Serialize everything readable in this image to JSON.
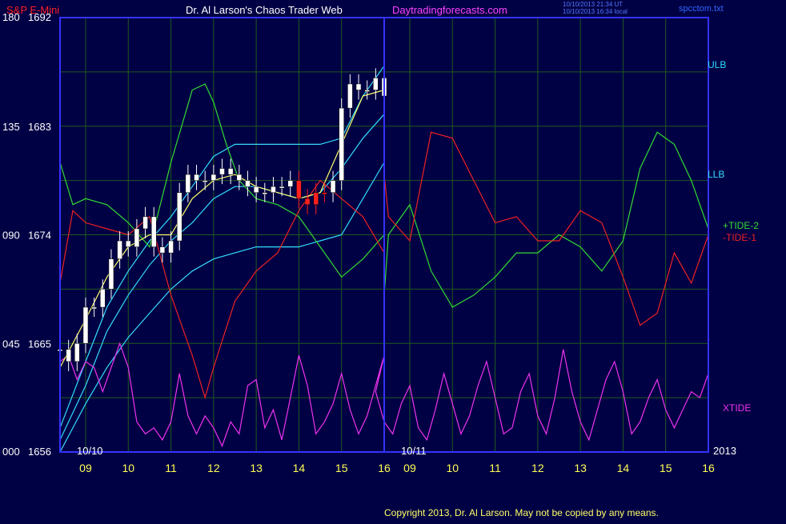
{
  "header": {
    "instrument": "S&P E-Mini",
    "title": "Dr. Al Larson's Chaos Trader Web",
    "website": "Daytradingforecasts.com",
    "timestamp_line1": "10/10/2013 21:34 UT",
    "timestamp_line2": "10/10/2013 16:34 local",
    "filename": "spcctom.txt"
  },
  "footer": {
    "copyright": "Copyright 2013, Dr. Al Larson. May not be copied by any means."
  },
  "colors": {
    "background": "#000044",
    "frame": "#3333ff",
    "grid": "#1f5a1f",
    "price_up": "#ffffff",
    "price_down": "#000000",
    "price_highlight": "#ff2020",
    "ulb": "#33ddff",
    "llb": "#33ddff",
    "tide_plus": "#33dd33",
    "tide_minus": "#ee2222",
    "xtide": "#ee33ee",
    "ma_yellow": "#ffff66",
    "axis_text": "#ffffff",
    "hour_labels": "#ffff55"
  },
  "chart_data": {
    "type": "line",
    "title": "S&P E-Mini",
    "xlabel": "",
    "ylabel": "",
    "ylim": [
      1656,
      1692
    ],
    "y_left_scale": [
      0,
      180
    ],
    "grid": true,
    "legend_position": "right",
    "y_ticks": [
      {
        "left": "180",
        "price": "1692",
        "value": 1692
      },
      {
        "left": "135",
        "price": "1683",
        "value": 1683
      },
      {
        "left": "090",
        "price": "1674",
        "value": 1674
      },
      {
        "left": "045",
        "price": "1665",
        "value": 1665
      },
      {
        "left": "000",
        "price": "1656",
        "value": 1656
      }
    ],
    "x_hour_ticks": [
      "09",
      "10",
      "11",
      "12",
      "13",
      "14",
      "15",
      "16",
      "09",
      "10",
      "11",
      "12",
      "13",
      "14",
      "15",
      "16"
    ],
    "date_labels": [
      "10/10",
      "10/11"
    ],
    "year_label": "2013",
    "series_labels": {
      "ulb": "ULB",
      "llb": "LLB",
      "tide_plus": "+TIDE-2",
      "tide_minus": "-TIDE-1",
      "xtide": "XTIDE"
    },
    "price_bars": {
      "hours": [
        8.4,
        8.6,
        8.8,
        9.0,
        9.2,
        9.4,
        9.6,
        9.8,
        10.0,
        10.2,
        10.4,
        10.6,
        10.8,
        11.0,
        11.2,
        11.4,
        11.6,
        11.8,
        12.0,
        12.2,
        12.4,
        12.6,
        12.8,
        13.0,
        13.2,
        13.4,
        13.6,
        13.8,
        14.0,
        14.2,
        14.4,
        14.6,
        14.8,
        15.0,
        15.2,
        15.4,
        15.6,
        15.8,
        16.0
      ],
      "prices": [
        1664.5,
        1663.5,
        1665.0,
        1668.0,
        1668.0,
        1669.5,
        1672.0,
        1673.5,
        1673.0,
        1674.5,
        1675.5,
        1673.0,
        1672.5,
        1673.5,
        1677.5,
        1679.0,
        1678.5,
        1678.5,
        1679.0,
        1679.5,
        1679.0,
        1678.5,
        1678.0,
        1677.5,
        1677.5,
        1678.0,
        1678.0,
        1678.5,
        1677.0,
        1676.5,
        1677.5,
        1677.5,
        1678.5,
        1684.5,
        1686.5,
        1686.0,
        1686.0,
        1687.0,
        1685.5
      ],
      "highlight_hours": [
        14.0,
        14.2,
        14.4,
        14.6
      ]
    },
    "ma_line": {
      "hours": [
        8.4,
        9.0,
        9.5,
        10.0,
        10.5,
        11.0,
        11.5,
        12.0,
        12.5,
        13.0,
        13.5,
        14.0,
        14.5,
        15.0,
        15.5,
        16.0
      ],
      "prices": [
        1663.0,
        1667.0,
        1670.5,
        1673.0,
        1674.0,
        1674.0,
        1677.0,
        1678.5,
        1679.0,
        1678.0,
        1677.5,
        1677.0,
        1677.5,
        1681.5,
        1685.5,
        1686.0
      ]
    },
    "series": [
      {
        "name": "ULB",
        "hours": [
          8.4,
          9.0,
          9.5,
          10.0,
          10.5,
          11.0,
          11.5,
          12.0,
          12.5,
          13.0,
          13.5,
          14.0,
          14.5,
          15.0,
          15.5,
          16.0
        ],
        "values": [
          1658.0,
          1663.5,
          1668.0,
          1671.0,
          1673.5,
          1675.5,
          1678.0,
          1680.5,
          1681.5,
          1681.5,
          1681.5,
          1681.5,
          1681.5,
          1682.0,
          1685.5,
          1688.0
        ]
      },
      {
        "name": "Middle band",
        "hours": [
          8.4,
          9.0,
          9.5,
          10.0,
          10.5,
          11.0,
          11.5,
          12.0,
          12.5,
          13.0,
          13.5,
          14.0,
          14.5,
          15.0,
          15.5,
          16.0
        ],
        "values": [
          1657.0,
          1661.5,
          1666.0,
          1669.0,
          1671.5,
          1673.5,
          1675.0,
          1677.0,
          1678.0,
          1678.0,
          1677.5,
          1677.0,
          1677.5,
          1679.5,
          1682.0,
          1684.0
        ]
      },
      {
        "name": "LLB",
        "hours": [
          8.4,
          9.0,
          9.5,
          10.0,
          10.5,
          11.0,
          11.5,
          12.0,
          12.5,
          13.0,
          13.5,
          14.0,
          14.5,
          15.0,
          15.5,
          16.0
        ],
        "values": [
          1656.0,
          1660.0,
          1663.0,
          1665.5,
          1667.5,
          1669.5,
          1671.0,
          1672.0,
          1672.5,
          1673.0,
          1673.0,
          1673.0,
          1673.5,
          1674.0,
          1677.0,
          1680.0
        ]
      },
      {
        "name": "+TIDE-2",
        "hours": [
          8.4,
          8.7,
          9.0,
          9.5,
          10.0,
          10.5,
          11.0,
          11.5,
          11.8,
          12.0,
          12.3,
          12.6,
          13.0,
          13.5,
          14.0,
          14.5,
          15.0,
          15.5,
          16.0,
          16.0,
          16.5,
          17.0,
          17.5,
          18.0,
          18.5,
          19.0,
          19.5,
          20.0,
          20.5,
          21.0,
          21.5,
          22.0,
          22.4,
          22.8,
          23.2,
          23.6,
          24.0
        ],
        "values": [
          1680.0,
          1676.5,
          1677.0,
          1676.5,
          1675.0,
          1673.0,
          1680.0,
          1686.0,
          1686.5,
          1685.0,
          1681.5,
          1678.5,
          1677.0,
          1676.5,
          1675.5,
          1673.0,
          1670.5,
          1672.0,
          1674.0,
          1669.0,
          1674.0,
          1676.5,
          1671.0,
          1668.0,
          1669.0,
          1670.5,
          1672.5,
          1672.5,
          1674.0,
          1673.0,
          1671.0,
          1673.5,
          1679.5,
          1682.5,
          1681.5,
          1678.5,
          1674.5
        ]
      },
      {
        "name": "-TIDE-1",
        "hours": [
          8.4,
          8.7,
          9.0,
          9.5,
          10.0,
          10.5,
          11.0,
          11.5,
          11.8,
          12.0,
          12.5,
          13.0,
          13.5,
          14.0,
          14.5,
          15.0,
          15.5,
          16.0,
          16.0,
          16.5,
          17.0,
          17.5,
          18.0,
          18.5,
          19.0,
          19.5,
          20.0,
          20.5,
          21.0,
          21.5,
          22.0,
          22.4,
          22.8,
          23.2,
          23.6,
          24.0
        ],
        "values": [
          1670.0,
          1676.0,
          1675.0,
          1674.5,
          1674.0,
          1675.5,
          1669.0,
          1664.0,
          1660.5,
          1663.0,
          1668.5,
          1671.0,
          1672.5,
          1676.0,
          1678.5,
          1677.0,
          1675.5,
          1672.5,
          1679.0,
          1675.5,
          1673.5,
          1682.5,
          1682.0,
          1678.5,
          1675.0,
          1675.5,
          1673.5,
          1673.5,
          1676.0,
          1675.0,
          1670.5,
          1666.5,
          1667.5,
          1672.5,
          1670.0,
          1674.0
        ]
      },
      {
        "name": "XTIDE",
        "hours": [
          8.4,
          8.6,
          8.8,
          9.0,
          9.2,
          9.4,
          9.6,
          9.8,
          10.0,
          10.2,
          10.4,
          10.6,
          10.8,
          11.0,
          11.2,
          11.4,
          11.6,
          11.8,
          12.0,
          12.2,
          12.4,
          12.6,
          12.8,
          13.0,
          13.2,
          13.4,
          13.6,
          13.8,
          14.0,
          14.2,
          14.4,
          14.6,
          14.8,
          15.0,
          15.2,
          15.4,
          15.6,
          15.8,
          16.0,
          16.2,
          16.4,
          16.6,
          16.8,
          17.0,
          17.2,
          17.4,
          17.6,
          17.8,
          18.0,
          18.2,
          18.4,
          18.6,
          18.8,
          19.0,
          19.2,
          19.4,
          19.6,
          19.8,
          20.0,
          20.2,
          20.4,
          20.6,
          20.8,
          21.0,
          21.2,
          21.4,
          21.6,
          21.8,
          22.0,
          22.2,
          22.4,
          22.6,
          22.8,
          23.0,
          23.2,
          23.4,
          23.6,
          23.8,
          24.0
        ],
        "values": [
          1663.5,
          1664.0,
          1662.0,
          1663.5,
          1663.0,
          1661.0,
          1663.0,
          1665.0,
          1663.0,
          1658.5,
          1657.5,
          1658.0,
          1657.0,
          1658.5,
          1662.5,
          1659.0,
          1657.5,
          1659.0,
          1658.0,
          1656.5,
          1658.5,
          1657.5,
          1661.5,
          1662.0,
          1658.0,
          1659.5,
          1657.0,
          1660.5,
          1664.0,
          1661.5,
          1657.5,
          1658.5,
          1660.0,
          1662.5,
          1659.5,
          1657.5,
          1659.0,
          1661.5,
          1664.0,
          1661.0,
          1658.5,
          1657.5,
          1660.0,
          1661.5,
          1658.0,
          1657.0,
          1659.5,
          1662.5,
          1660.0,
          1657.5,
          1659.0,
          1661.5,
          1663.5,
          1660.5,
          1657.5,
          1658.0,
          1661.0,
          1662.5,
          1659.0,
          1657.5,
          1660.5,
          1664.5,
          1661.0,
          1658.5,
          1657.0,
          1659.5,
          1662.0,
          1663.5,
          1661.0,
          1657.5,
          1658.5,
          1660.5,
          1662.0,
          1659.5,
          1658.0,
          1659.5,
          1661.0,
          1660.5,
          1662.5
        ]
      }
    ]
  }
}
